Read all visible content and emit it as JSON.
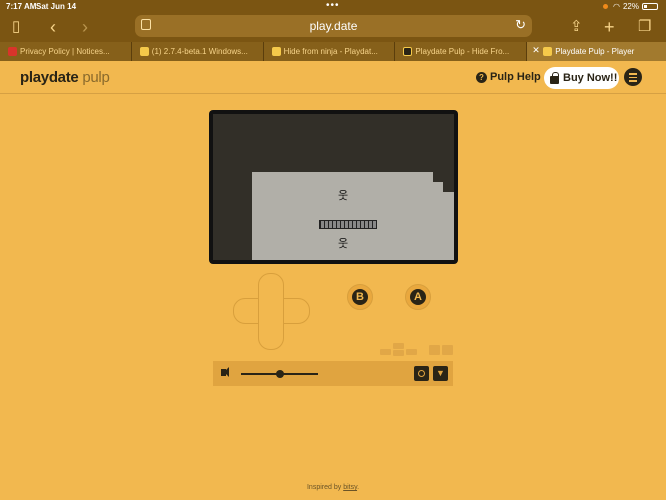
{
  "status_bar": {
    "time": "7:17 AM",
    "date": "Sat Jun 14",
    "dots": "•••",
    "battery": "22%"
  },
  "toolbar": {
    "url": "play.date"
  },
  "tabs": [
    {
      "label": "Privacy Policy | Notices...",
      "icon_color": "#d9342b"
    },
    {
      "label": "(1) 2.7.4-beta.1 Windows...",
      "icon_color": "#f5c94a"
    },
    {
      "label": "Hide from ninja - Playdat...",
      "icon_color": "#f5c94a"
    },
    {
      "label": "Playdate Pulp - Hide Fro...",
      "icon_color": "#2a2416"
    },
    {
      "label": "Playdate Pulp - Player",
      "icon_color": "#f5c94a",
      "active": true
    }
  ],
  "header": {
    "logo_primary": "playdate",
    "logo_secondary": "pulp",
    "help_label": "Pulp Help",
    "buy_label": "Buy Now!!"
  },
  "controls": {
    "b_label": "B",
    "a_label": "A"
  },
  "player": {
    "volume_level": 0.5
  },
  "footer": {
    "text": "Inspired by",
    "link": "bitsy",
    "suffix": "."
  },
  "colors": {
    "page_bg": "#f2b84f",
    "browser_chrome": "#7b5512",
    "screen_dark": "#322f28",
    "screen_floor": "#b1afa8"
  }
}
